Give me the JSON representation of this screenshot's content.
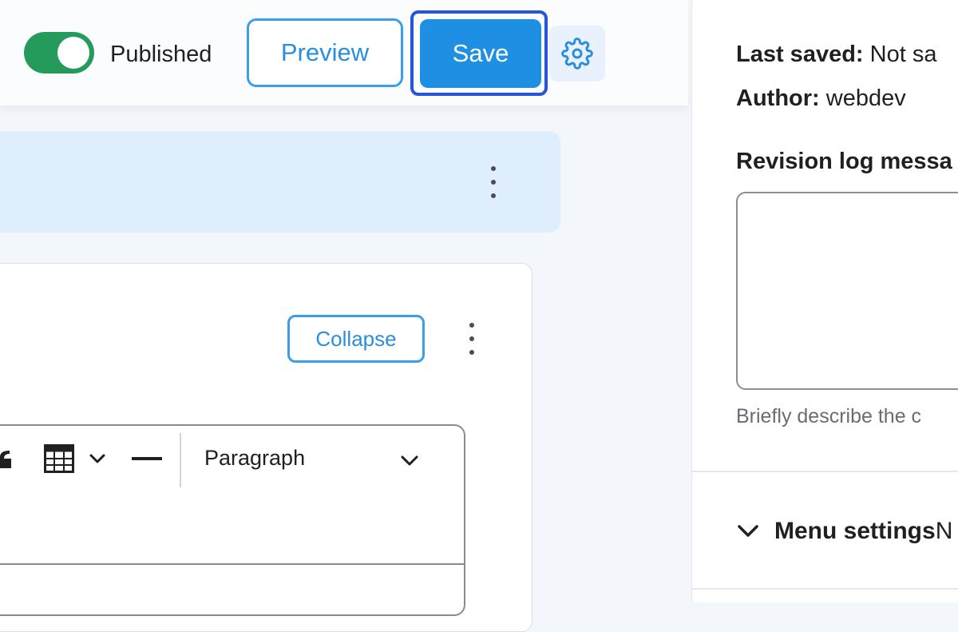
{
  "toolbar": {
    "status_toggle": {
      "checked": true
    },
    "status_label": "Published",
    "preview_label": "Preview",
    "save_label": "Save",
    "settings_icon": "gear-icon"
  },
  "block": {
    "actions_icon": "kebab-icon"
  },
  "card": {
    "collapse_label": "Collapse",
    "actions_icon": "kebab-icon"
  },
  "editor_toolbar": {
    "icons": [
      "blockquote-icon",
      "table-icon",
      "chevron-down-icon",
      "horizontal-line-icon"
    ],
    "format_value": "Paragraph"
  },
  "sidebar": {
    "last_saved_label": "Last saved:",
    "last_saved_value": "Not sa",
    "author_label": "Author:",
    "author_value": "webdev",
    "revision_label": "Revision log messa",
    "revision_help": "Briefly describe the c",
    "menu_settings_label": "Menu settings",
    "menu_settings_trail": "N"
  },
  "colors": {
    "accent": "#1f8fe3",
    "toggle_on": "#249b5a",
    "focus_ring": "#2356d8"
  }
}
